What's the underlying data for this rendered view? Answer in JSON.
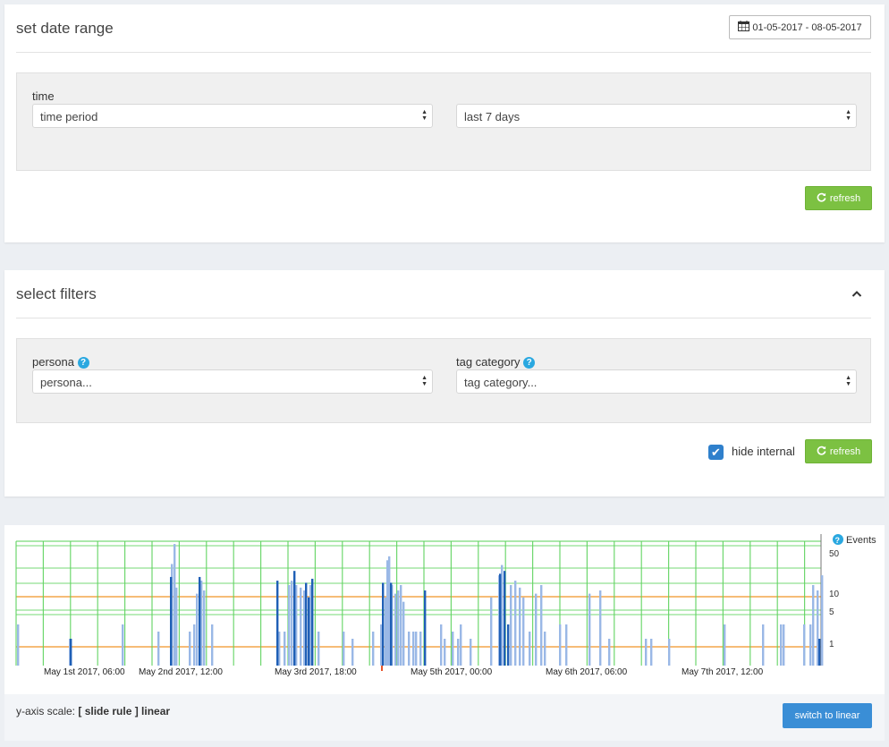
{
  "date_range_panel": {
    "title": "set date range",
    "date_button": "01-05-2017 - 08-05-2017",
    "time_label": "time",
    "time_select": "time period",
    "period_select": "last 7 days",
    "refresh_label": "refresh"
  },
  "filters_panel": {
    "title": "select filters",
    "persona_label": "persona",
    "persona_placeholder": "persona...",
    "tag_label": "tag category",
    "tag_placeholder": "tag category...",
    "hide_internal_label": "hide internal",
    "hide_internal_checked": true,
    "refresh_label": "refresh"
  },
  "chart_data": {
    "type": "bar",
    "legend": "Events",
    "y_scale": "slide rule",
    "y_ticks": [
      50,
      10,
      5,
      1
    ],
    "x_tick_labels": [
      "May 1st 2017, 06:00",
      "May 2nd 2017, 12:00",
      "May 3rd 2017, 18:00",
      "May 5th 2017, 00:00",
      "May 6th 2017, 06:00",
      "May 7th 2017, 12:00"
    ],
    "colors": {
      "light": "#9ab8e6",
      "dark": "#1f5fb6",
      "grid": "#5fd35f",
      "ref": "#f4a64a",
      "marker": "#e8542a"
    },
    "series": [
      {
        "name": "light",
        "bars": [
          [
            19,
            4
          ],
          [
            77,
            2
          ],
          [
            136,
            4
          ],
          [
            176,
            3
          ],
          [
            191,
            24
          ],
          [
            194,
            55
          ],
          [
            196,
            9
          ],
          [
            211,
            3
          ],
          [
            216,
            4
          ],
          [
            219,
            7
          ],
          [
            224,
            12
          ],
          [
            227,
            8
          ],
          [
            236,
            4
          ],
          [
            311,
            3
          ],
          [
            317,
            3
          ],
          [
            322,
            10
          ],
          [
            325,
            12
          ],
          [
            330,
            10
          ],
          [
            335,
            9
          ],
          [
            339,
            8
          ],
          [
            346,
            10
          ],
          [
            355,
            3
          ],
          [
            383,
            3
          ],
          [
            393,
            2
          ],
          [
            416,
            3
          ],
          [
            425,
            4
          ],
          [
            430,
            6
          ],
          [
            432,
            28
          ],
          [
            434,
            33
          ],
          [
            437,
            10
          ],
          [
            441,
            7
          ],
          [
            444,
            8
          ],
          [
            447,
            10
          ],
          [
            450,
            5
          ],
          [
            456,
            3
          ],
          [
            461,
            3
          ],
          [
            464,
            3
          ],
          [
            469,
            3
          ],
          [
            492,
            4
          ],
          [
            496,
            2
          ],
          [
            505,
            3
          ],
          [
            511,
            2
          ],
          [
            514,
            4
          ],
          [
            525,
            2
          ],
          [
            548,
            6
          ],
          [
            557,
            15
          ],
          [
            560,
            23
          ],
          [
            570,
            10
          ],
          [
            575,
            12
          ],
          [
            580,
            9
          ],
          [
            584,
            6
          ],
          [
            591,
            3
          ],
          [
            598,
            7
          ],
          [
            604,
            10
          ],
          [
            608,
            3
          ],
          [
            625,
            4
          ],
          [
            632,
            4
          ],
          [
            658,
            7
          ],
          [
            670,
            8
          ],
          [
            680,
            2
          ],
          [
            721,
            2
          ],
          [
            727,
            2
          ],
          [
            747,
            2
          ],
          [
            809,
            4
          ],
          [
            852,
            4
          ],
          [
            872,
            4
          ],
          [
            875,
            4
          ],
          [
            898,
            4
          ],
          [
            905,
            4
          ],
          [
            908,
            10
          ],
          [
            913,
            8
          ],
          [
            918,
            15
          ]
        ]
      },
      {
        "name": "dark",
        "bars": [
          [
            78,
            2
          ],
          [
            190,
            14
          ],
          [
            222,
            14
          ],
          [
            309,
            12
          ],
          [
            328,
            18
          ],
          [
            341,
            11
          ],
          [
            344,
            6
          ],
          [
            348,
            13
          ],
          [
            427,
            11
          ],
          [
            436,
            11
          ],
          [
            474,
            8
          ],
          [
            558,
            16
          ],
          [
            563,
            18
          ],
          [
            567,
            4
          ],
          [
            915,
            2
          ]
        ]
      }
    ]
  },
  "footer": {
    "scale_label": "y-axis scale:",
    "scale_value": "[ slide rule ] linear",
    "switch_button": "switch to linear"
  }
}
